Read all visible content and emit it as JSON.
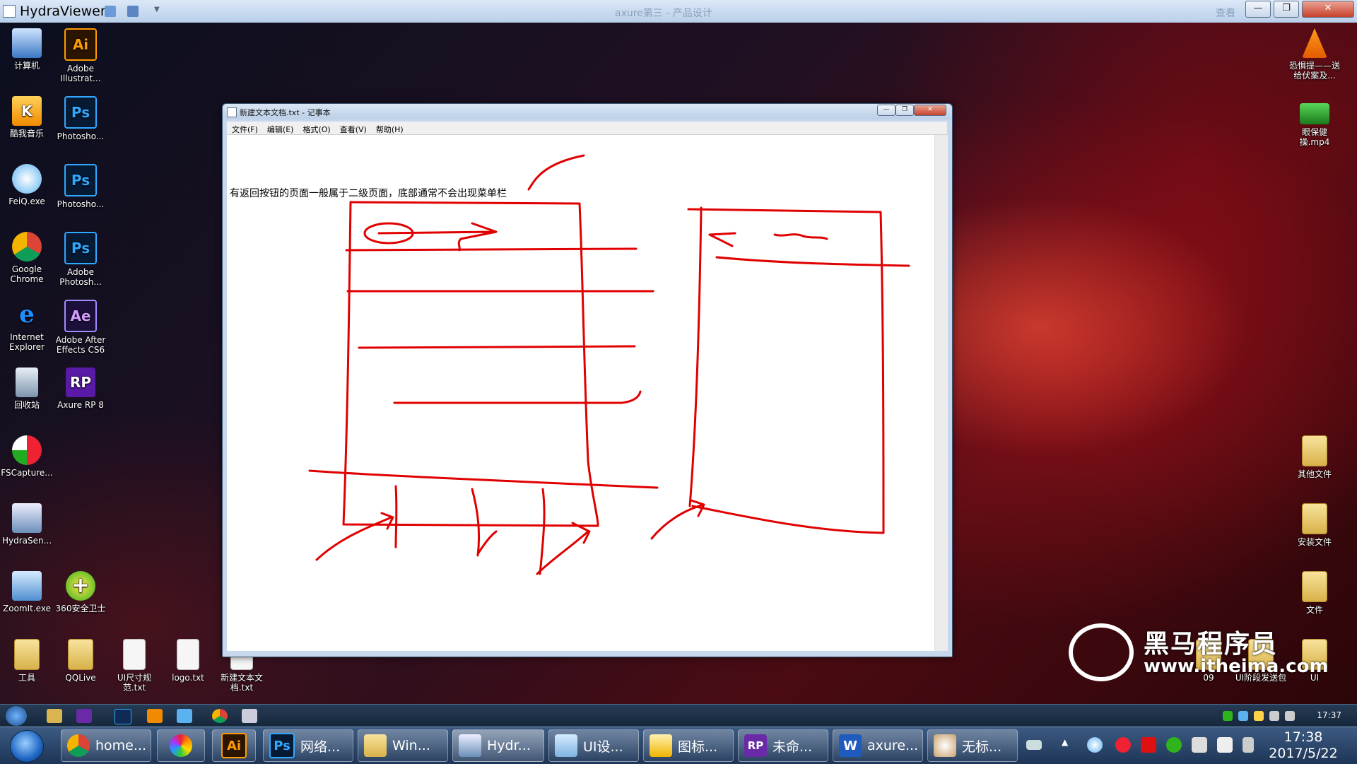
{
  "host": {
    "title": "HydraViewer",
    "ghost_title": "axure第三 - 产品设计",
    "ghost_right": "查看"
  },
  "desktop_left": [
    {
      "label": "计算机",
      "icon": "computer-icon"
    },
    {
      "label": "Adobe Illustrat...",
      "icon": "adobe-illustrator-icon",
      "glyph": "Ai"
    },
    {
      "label": "酷我音乐",
      "icon": "kuwo-music-icon",
      "glyph": "K"
    },
    {
      "label": "Photosho...",
      "icon": "photoshop-icon",
      "glyph": "Ps"
    },
    {
      "label": "FeiQ.exe",
      "icon": "feiq-icon"
    },
    {
      "label": "Photosho...",
      "icon": "photoshop-icon-2",
      "glyph": "Ps"
    },
    {
      "label": "Google Chrome",
      "icon": "chrome-icon"
    },
    {
      "label": "Adobe Photosh...",
      "icon": "photoshop-icon-3",
      "glyph": "Ps"
    },
    {
      "label": "Internet Explorer",
      "icon": "ie-icon",
      "glyph": "e"
    },
    {
      "label": "Adobe After Effects CS6",
      "icon": "after-effects-icon",
      "glyph": "Ae"
    },
    {
      "label": "回收站",
      "icon": "recycle-bin-icon"
    },
    {
      "label": "Axure RP 8",
      "icon": "axure-icon",
      "glyph": "RP"
    },
    {
      "label": "FSCapture...",
      "icon": "fscapture-icon"
    },
    {
      "label": "HydraSen...",
      "icon": "hydrasender-icon"
    },
    {
      "label": "ZoomIt.exe",
      "icon": "zoomit-icon"
    },
    {
      "label": "360安全卫士",
      "icon": "360-security-icon",
      "glyph": "+"
    },
    {
      "label": "工具",
      "icon": "folder-icon"
    },
    {
      "label": "QQLive",
      "icon": "folder-icon"
    },
    {
      "label": "UI尺寸规范.txt",
      "icon": "text-file-icon"
    },
    {
      "label": "logo.txt",
      "icon": "text-file-icon"
    },
    {
      "label": "新建文本文档.txt",
      "icon": "text-file-icon"
    }
  ],
  "desktop_right": [
    {
      "label": "恐惧提——送给伏案及...",
      "icon": "vlc-icon"
    },
    {
      "label": "眼保健操.mp4",
      "icon": "video-file-icon"
    },
    {
      "label": "其他文件",
      "icon": "folder-icon"
    },
    {
      "label": "安装文件",
      "icon": "folder-icon"
    },
    {
      "label": "文件",
      "icon": "folder-icon"
    },
    {
      "label": "09",
      "icon": "folder-icon"
    },
    {
      "label": "UI阶段发送包",
      "icon": "folder-icon"
    },
    {
      "label": "UI",
      "icon": "folder-icon"
    }
  ],
  "notepad": {
    "title": "新建文本文档.txt - 记事本",
    "menu": [
      "文件(F)",
      "编辑(E)",
      "格式(O)",
      "查看(V)",
      "帮助(H)"
    ],
    "content": "有返回按钮的页面一般属于二级页面，底部通常不会出现菜单栏"
  },
  "watermark": {
    "name": "黑马程序员",
    "url": "www.itheima.com"
  },
  "inner_taskbar": {
    "clock": "17:37"
  },
  "taskbar": {
    "buttons": [
      {
        "label": "home...",
        "icon": "chrome-icon"
      },
      {
        "label": "",
        "icon": "picasa-icon"
      },
      {
        "label": "",
        "icon": "illustrator-icon",
        "glyph": "Ai"
      },
      {
        "label": "网络...",
        "icon": "photoshop-icon",
        "glyph": "Ps"
      },
      {
        "label": "Win...",
        "icon": "explorer-icon"
      },
      {
        "label": "Hydr...",
        "icon": "hydraviewer-icon"
      },
      {
        "label": "UI设...",
        "icon": "notepad-icon"
      },
      {
        "label": "图标...",
        "icon": "image-viewer-icon"
      },
      {
        "label": "未命...",
        "icon": "axure-icon",
        "glyph": "RP"
      },
      {
        "label": "axure...",
        "icon": "word-icon",
        "glyph": "W"
      },
      {
        "label": "无标...",
        "icon": "paint-icon"
      }
    ],
    "time": "17:38",
    "date": "2017/5/22"
  },
  "colors": {
    "sketch": "#e00000",
    "taskbar": "#2a4670"
  }
}
